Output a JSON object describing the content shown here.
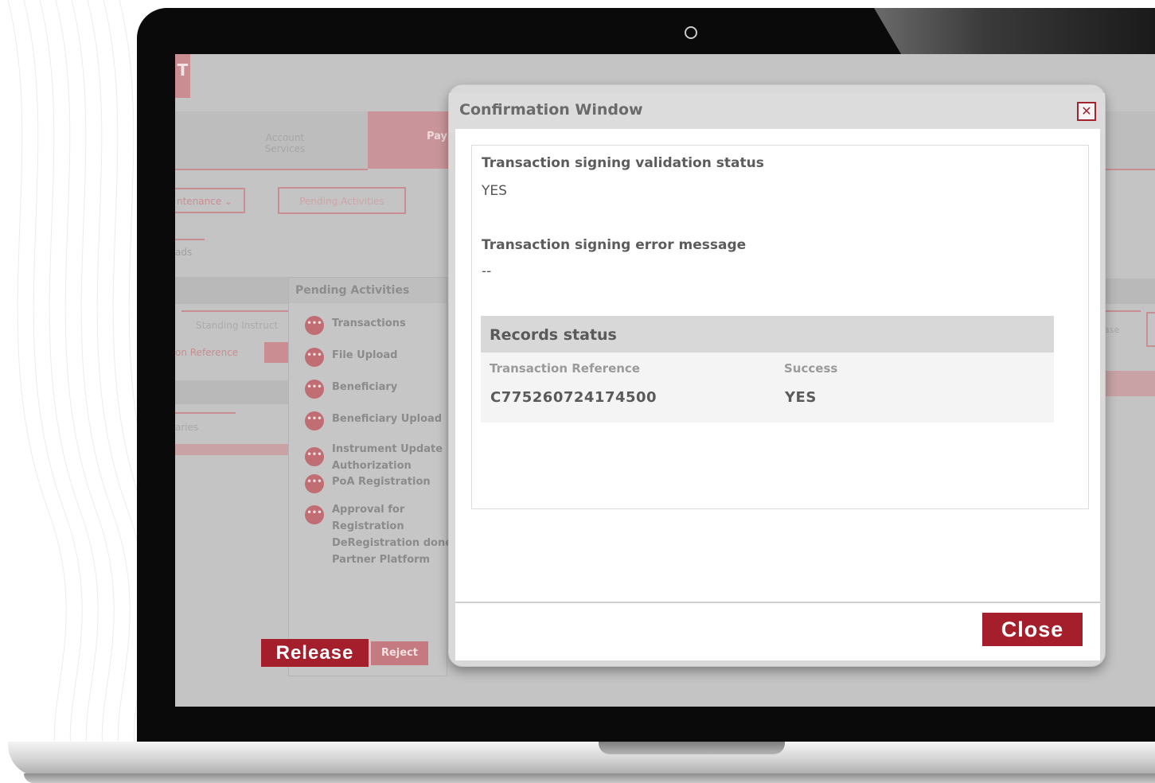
{
  "background": {
    "nav": {
      "tab_account_line1": "Account",
      "tab_account_line2": "Services",
      "tab_active": "Pay"
    },
    "logo_letter": "T",
    "maintenance_dropdown": "ntenance",
    "pending_activities_button": "Pending Activities",
    "sub_tab": "ads",
    "standing_instruction_tab": "Standing Instruct",
    "reference_label": "on Reference",
    "beneficiaries_tab": "aries",
    "right_release_tab": "ase"
  },
  "pending_panel": {
    "title": "Pending Activities",
    "items": [
      {
        "label": "Transactions"
      },
      {
        "label": "File Upload"
      },
      {
        "label": "Beneficiary"
      },
      {
        "label": "Beneficiary Upload"
      },
      {
        "label": "Instrument Update",
        "label2": "Authorization"
      },
      {
        "label": "PoA Registration"
      },
      {
        "label": "Approval for",
        "label2": "Registration",
        "label3": "DeRegistration done",
        "label4": "Partner Platform"
      }
    ],
    "release_label": "Release",
    "reject_label": "Reject"
  },
  "modal": {
    "title": "Confirmation Window",
    "close_icon_glyph": "✕",
    "signing_status_label": "Transaction signing validation status",
    "signing_status_value": "YES",
    "error_label": "Transaction signing error message",
    "error_value": "--",
    "records": {
      "title": "Records status",
      "columns": [
        "Transaction Reference",
        "Success"
      ],
      "rows": [
        [
          "C775260724174500",
          "YES"
        ]
      ]
    },
    "close_button": "Close"
  },
  "colors": {
    "accent": "#a51e2b",
    "muted_accent": "#c88e93",
    "screen_dim": "#c4c4c4"
  }
}
